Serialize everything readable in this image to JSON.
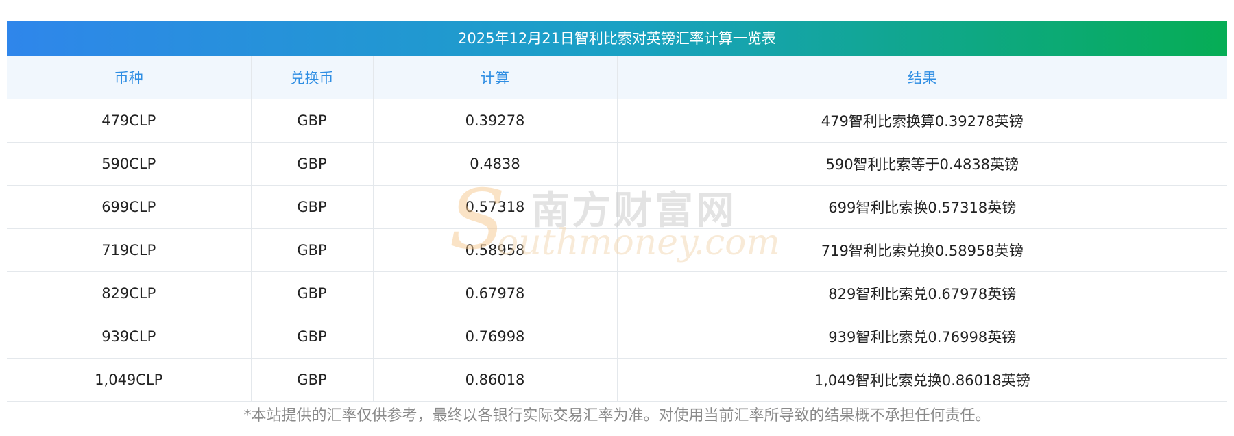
{
  "title": "2025年12月21日智利比索对英镑汇率计算一览表",
  "columns": [
    "币种",
    "兑换币",
    "计算",
    "结果"
  ],
  "rows": [
    {
      "currency": "479CLP",
      "target": "GBP",
      "value": "0.39278",
      "result": "479智利比索换算0.39278英镑"
    },
    {
      "currency": "590CLP",
      "target": "GBP",
      "value": "0.4838",
      "result": "590智利比索等于0.4838英镑"
    },
    {
      "currency": "699CLP",
      "target": "GBP",
      "value": "0.57318",
      "result": "699智利比索换0.57318英镑"
    },
    {
      "currency": "719CLP",
      "target": "GBP",
      "value": "0.58958",
      "result": "719智利比索兑换0.58958英镑"
    },
    {
      "currency": "829CLP",
      "target": "GBP",
      "value": "0.67978",
      "result": "829智利比索兑0.67978英镑"
    },
    {
      "currency": "939CLP",
      "target": "GBP",
      "value": "0.76998",
      "result": "939智利比索兑0.76998英镑"
    },
    {
      "currency": "1,049CLP",
      "target": "GBP",
      "value": "0.86018",
      "result": "1,049智利比索兑换0.86018英镑"
    }
  ],
  "footnote": "*本站提供的汇率仅供参考，最终以各银行实际交易汇率为准。对使用当前汇率所导致的结果概不承担任何责任。",
  "watermark": {
    "cn": "南方财富网",
    "en": "outhmoney.com",
    "s": "S"
  },
  "colors": {
    "header_text": "#2f8ee3",
    "gradient_start": "#2f86eb",
    "gradient_end": "#06ad55"
  }
}
